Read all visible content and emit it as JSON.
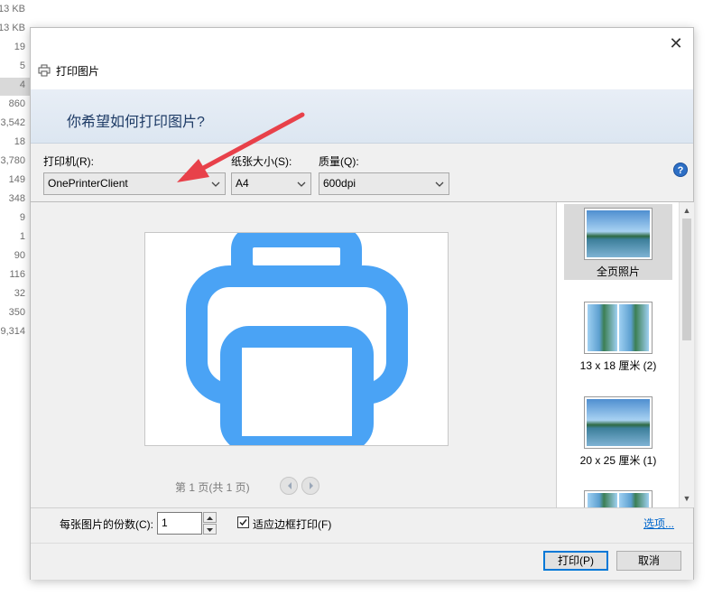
{
  "background_list": {
    "sizes": [
      "13 KB",
      "13 KB",
      "19",
      "5",
      "4",
      "860",
      "3,542",
      "18",
      "3,780",
      "149",
      "348",
      "9",
      "1",
      "90",
      "116",
      "32",
      "350",
      "9,314"
    ]
  },
  "dialog": {
    "title": "打印图片",
    "heading": "你希望如何打印图片?",
    "printer_label": "打印机(R):",
    "printer_value": "OnePrinterClient",
    "paper_label": "纸张大小(S):",
    "paper_value": "A4",
    "quality_label": "质量(Q):",
    "quality_value": "600dpi",
    "help_glyph": "?",
    "pager_text": "第 1 页(共 1 页)",
    "copies_label": "每张图片的份数(C):",
    "copies_value": "1",
    "fit_label": "适应边框打印(F)",
    "fit_checked": true,
    "options_link": "选项...",
    "print_button": "打印(P)",
    "cancel_button": "取消",
    "close_glyph": "✕"
  },
  "layouts": [
    {
      "label": "全页照片",
      "selected": true,
      "kind": "full"
    },
    {
      "label": "13 x 18 厘米 (2)",
      "selected": false,
      "kind": "split"
    },
    {
      "label": "20 x 25 厘米 (1)",
      "selected": false,
      "kind": "full"
    },
    {
      "label": "",
      "selected": false,
      "kind": "split"
    }
  ],
  "colors": {
    "accent": "#0078d7",
    "preview_icon": "#4aa3f5",
    "annotation_arrow": "#e8414a",
    "link": "#0066cc"
  },
  "icons": {
    "title": "printer-icon",
    "preview": "printer-icon",
    "help": "help-icon",
    "close": "close-icon"
  }
}
